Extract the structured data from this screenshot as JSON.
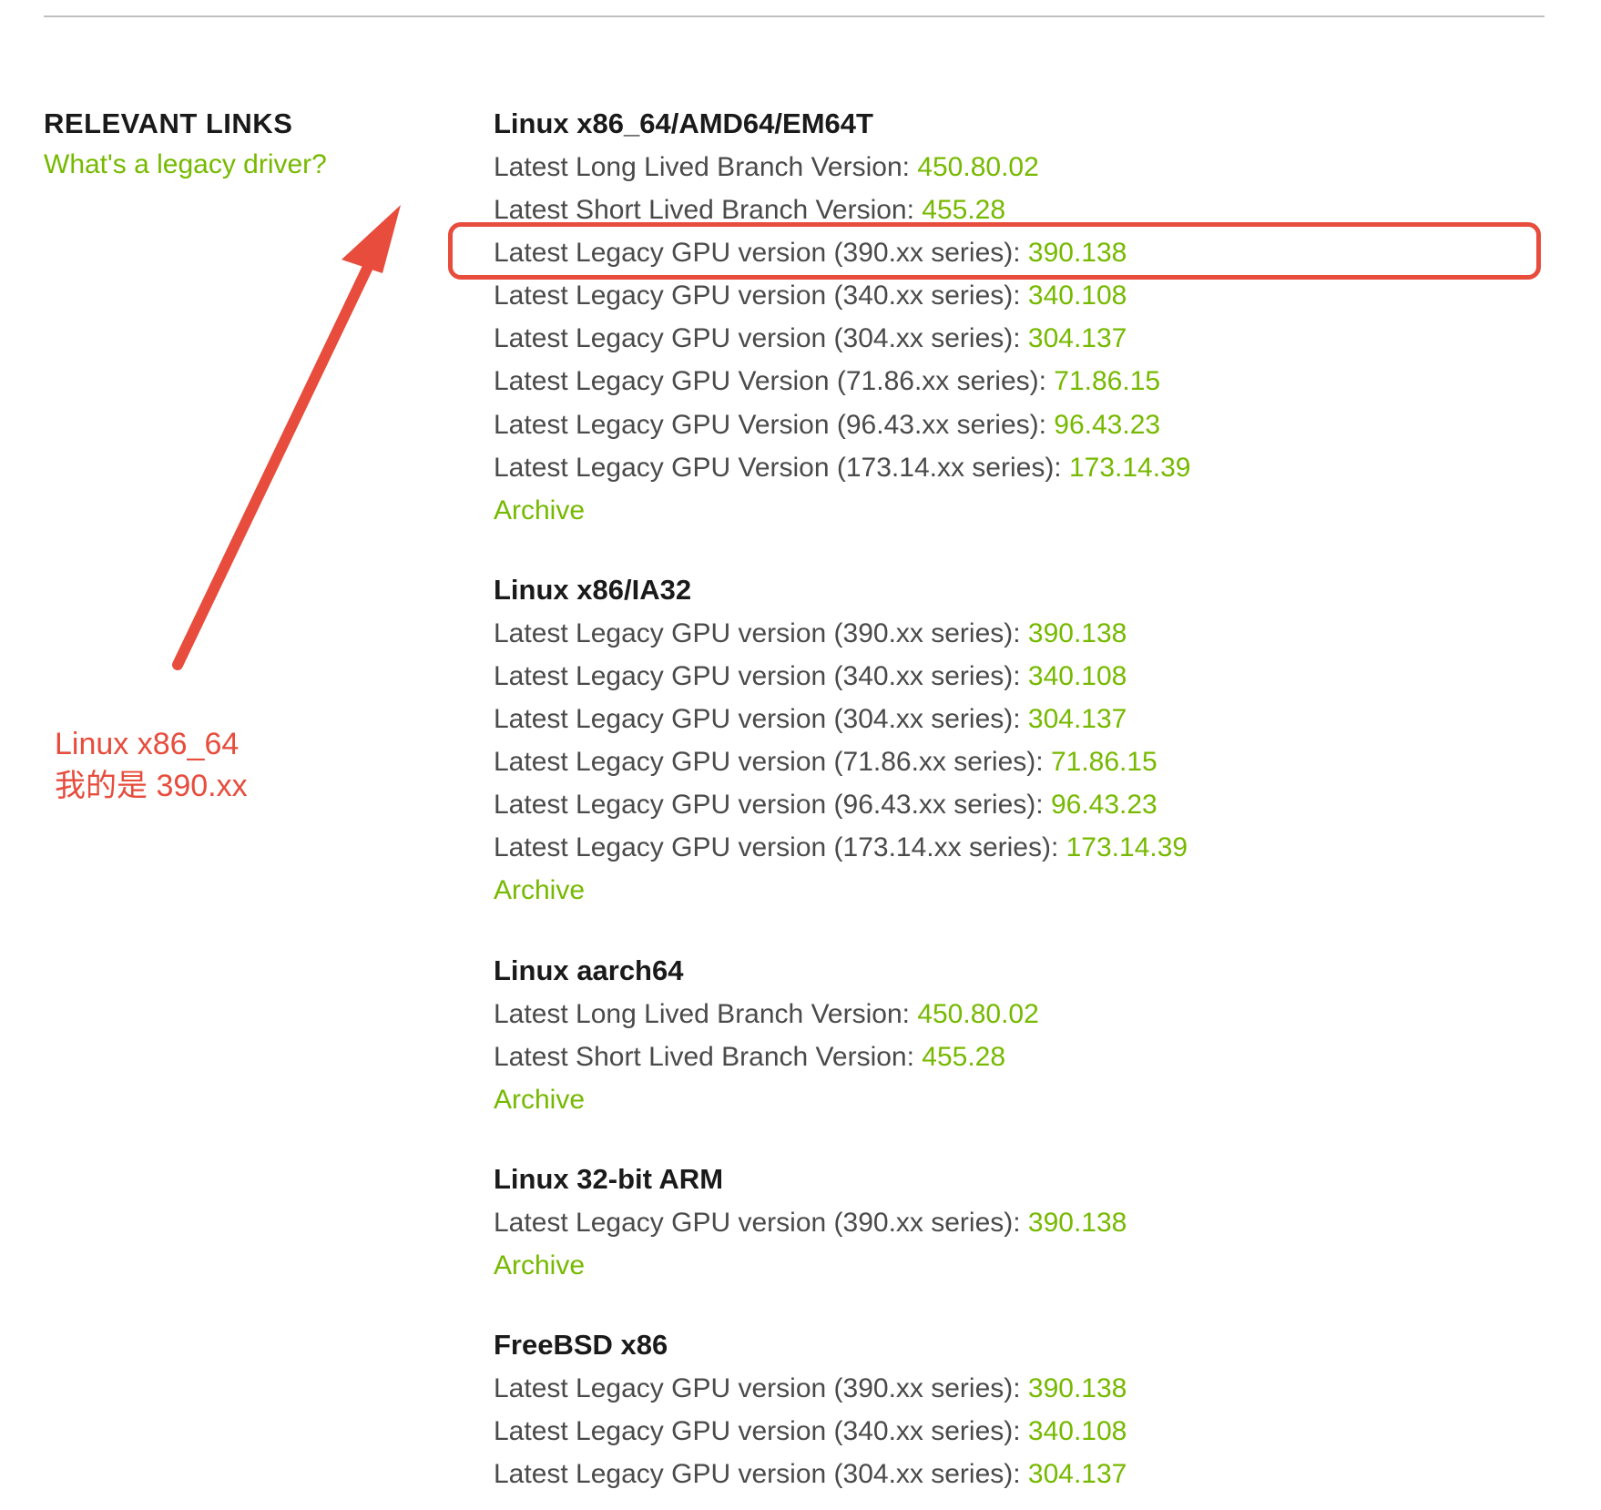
{
  "colors": {
    "link_green": "#76b900",
    "annotation_red": "#e74c3c",
    "body_text": "#4a4a4a",
    "heading_text": "#1a1a1a"
  },
  "sidebar": {
    "title": "RELEVANT LINKS",
    "link": "What's a legacy driver?"
  },
  "annotation": {
    "line1": "Linux x86_64",
    "line2": "我的是 390.xx"
  },
  "highlight": {
    "section_index": 0,
    "entry_index": 2
  },
  "sections": [
    {
      "title": "Linux x86_64/AMD64/EM64T",
      "entries": [
        {
          "label": "Latest Long Lived Branch Version: ",
          "version": "450.80.02"
        },
        {
          "label": "Latest Short Lived Branch Version: ",
          "version": "455.28"
        },
        {
          "label": "Latest Legacy GPU version (390.xx series): ",
          "version": "390.138"
        },
        {
          "label": "Latest Legacy GPU version (340.xx series): ",
          "version": "340.108"
        },
        {
          "label": "Latest Legacy GPU version (304.xx series): ",
          "version": "304.137"
        },
        {
          "label": "Latest Legacy GPU Version (71.86.xx series): ",
          "version": "71.86.15"
        },
        {
          "label": "Latest Legacy GPU Version (96.43.xx series): ",
          "version": "96.43.23"
        },
        {
          "label": "Latest Legacy GPU Version (173.14.xx series): ",
          "version": "173.14.39"
        }
      ],
      "archive": "Archive"
    },
    {
      "title": "Linux x86/IA32",
      "entries": [
        {
          "label": "Latest Legacy GPU version (390.xx series): ",
          "version": "390.138"
        },
        {
          "label": "Latest Legacy GPU version (340.xx series): ",
          "version": "340.108"
        },
        {
          "label": "Latest Legacy GPU version (304.xx series): ",
          "version": "304.137"
        },
        {
          "label": "Latest Legacy GPU version (71.86.xx series): ",
          "version": "71.86.15"
        },
        {
          "label": "Latest Legacy GPU version (96.43.xx series): ",
          "version": "96.43.23"
        },
        {
          "label": "Latest Legacy GPU version (173.14.xx series): ",
          "version": "173.14.39"
        }
      ],
      "archive": "Archive"
    },
    {
      "title": "Linux aarch64",
      "entries": [
        {
          "label": "Latest Long Lived Branch Version: ",
          "version": "450.80.02"
        },
        {
          "label": "Latest Short Lived Branch Version: ",
          "version": "455.28"
        }
      ],
      "archive": "Archive"
    },
    {
      "title": "Linux 32-bit ARM",
      "entries": [
        {
          "label": "Latest Legacy GPU version (390.xx series): ",
          "version": "390.138"
        }
      ],
      "archive": "Archive"
    },
    {
      "title": "FreeBSD x86",
      "entries": [
        {
          "label": "Latest Legacy GPU version (390.xx series): ",
          "version": "390.138"
        },
        {
          "label": "Latest Legacy GPU version (340.xx series): ",
          "version": "340.108"
        },
        {
          "label": "Latest Legacy GPU version (304.xx series): ",
          "version": "304.137"
        }
      ],
      "archive": null
    }
  ]
}
